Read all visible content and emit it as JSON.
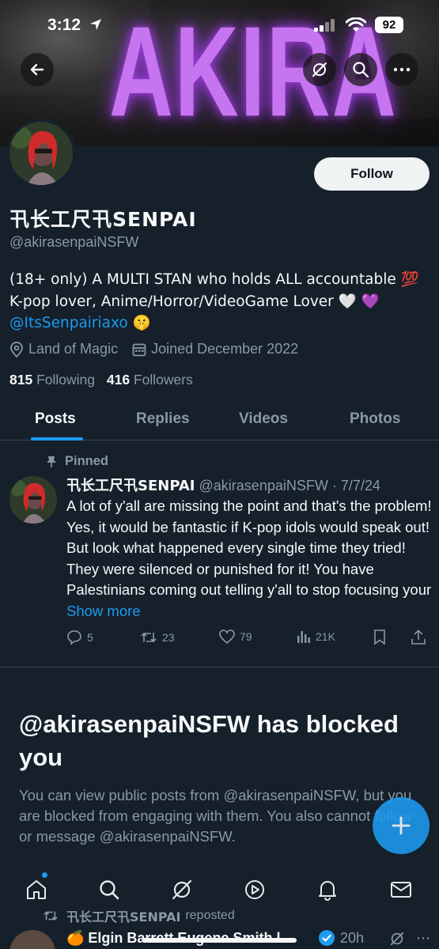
{
  "status_bar": {
    "time": "3:12",
    "battery": "92"
  },
  "banner": {
    "title": "AKIRA"
  },
  "profile": {
    "follow_label": "Follow",
    "display_name": "卂长工尺卂SENPAI",
    "handle": "@akirasenpaiNSFW",
    "bio_part1": "(18+ only) A MULTI STAN who holds ALL accountable 💯 K-pop lover, Anime/Horror/VideoGame Lover 🤍 💜 ",
    "bio_mention": "@ItsSenpairiaxo",
    "bio_part2": " 🤫",
    "location": "Land of Magic",
    "joined": "Joined December 2022",
    "following_count": "815",
    "following_label": "Following",
    "followers_count": "416",
    "followers_label": "Followers"
  },
  "tabs": [
    {
      "label": "Posts"
    },
    {
      "label": "Replies"
    },
    {
      "label": "Videos"
    },
    {
      "label": "Photos"
    }
  ],
  "pinned_post": {
    "pinned_label": "Pinned",
    "author_name": "卂长工尺卂SENPAI",
    "author_handle": "@akirasenpaiNSFW",
    "date": "7/7/24",
    "text": "A lot of y'all are missing the point and that's the problem! Yes, it would be fantastic if K-pop idols would speak out! But look what happened every single time they tried! They were silenced or punished for it! You have Palestinians coming out telling y'all to stop focusing your ",
    "show_more": "Show more",
    "replies": "5",
    "reposts": "23",
    "likes": "79",
    "views": "21K"
  },
  "blocked": {
    "title": "@akirasenpaiNSFW has blocked you",
    "description": "You can view public posts from @akirasenpaiNSFW, but you are blocked from engaging with them. You also cannot follow or message @akirasenpaiNSFW."
  },
  "next_post": {
    "reposter": "卂长工尺卂SENPAI",
    "reposted_label": "reposted",
    "author_name": "🍊 Elgin Barrett Eugene Smith l...",
    "time": "20h"
  },
  "colors": {
    "accent": "#1d9bf0",
    "background": "#15202b",
    "banner_text": "#c774f0"
  },
  "icons": [
    "back-arrow-icon",
    "grok-icon",
    "search-icon",
    "more-icon",
    "location-icon",
    "calendar-icon",
    "pin-icon",
    "reply-icon",
    "repost-icon",
    "like-icon",
    "views-icon",
    "bookmark-icon",
    "share-icon",
    "plus-icon",
    "home-icon",
    "explore-icon",
    "spaces-icon",
    "notifications-icon",
    "messages-icon",
    "verified-icon"
  ]
}
